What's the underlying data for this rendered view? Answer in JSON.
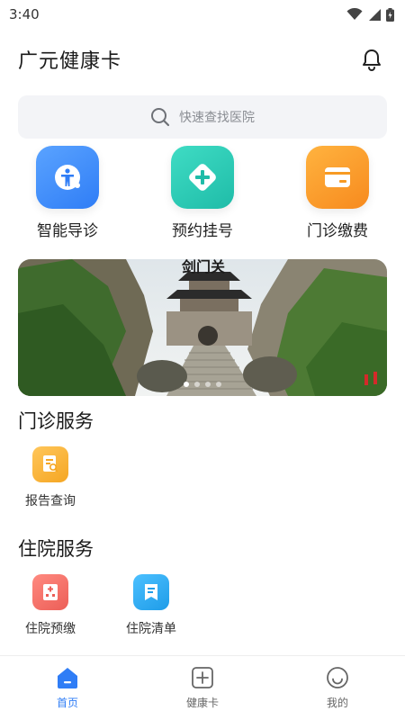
{
  "status_bar": {
    "time": "3:40"
  },
  "header": {
    "title": "广元健康卡",
    "notification_icon": "bell-icon"
  },
  "search": {
    "placeholder": "快速查找医院",
    "icon": "search-icon"
  },
  "quick_actions": [
    {
      "label": "智能导诊",
      "icon": "guide-person-icon",
      "color": "#3f8cf5"
    },
    {
      "label": "预约挂号",
      "icon": "plus-diamond-icon",
      "color": "#25c9b3"
    },
    {
      "label": "门诊缴费",
      "icon": "card-icon",
      "color": "#f79a23"
    }
  ],
  "banner": {
    "image": "pavilion-gate-landscape",
    "overlay_text": "剑门关",
    "page_count": 4,
    "active_page": 1
  },
  "outpatient": {
    "title": "门诊服务",
    "items": [
      {
        "label": "报告查询",
        "icon": "report-search-icon",
        "color": "#f5b13d"
      }
    ]
  },
  "inpatient": {
    "title": "住院服务",
    "items": [
      {
        "label": "住院预缴",
        "icon": "hospital-prepay-icon",
        "color": "#f0706a"
      },
      {
        "label": "住院清单",
        "icon": "bill-list-icon",
        "color": "#2ea7ef"
      }
    ]
  },
  "tabbar": {
    "tabs": [
      {
        "label": "首页",
        "icon": "home-icon",
        "active": true
      },
      {
        "label": "健康卡",
        "icon": "health-card-icon",
        "active": false
      },
      {
        "label": "我的",
        "icon": "smile-icon",
        "active": false
      }
    ],
    "active_color": "#2f7df6"
  }
}
